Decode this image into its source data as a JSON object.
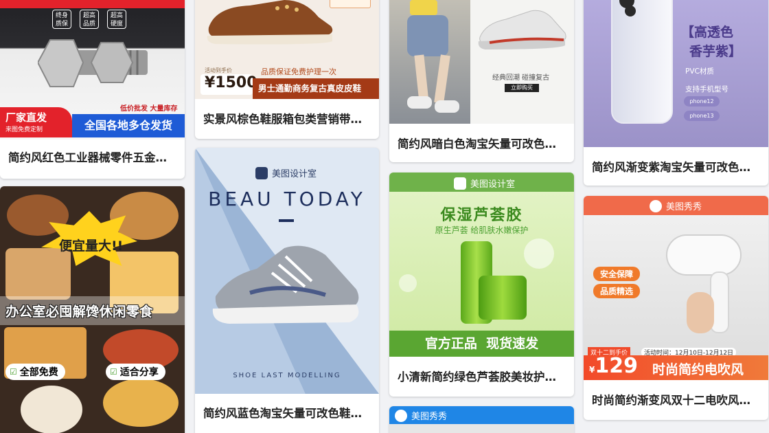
{
  "cards": [
    {
      "title": "简约风红色工业器械零件五金…",
      "image": {
        "badges": [
          "终身\n质保",
          "超高\n品质",
          "超高\n硬度"
        ],
        "tagline": "低价批发 大量库存",
        "factory_title": "厂家直发",
        "factory_sub": "来图免费定制",
        "banner": "全国各地多仓发货"
      }
    },
    {
      "title": "实景风棕色鞋服箱包类营销带…",
      "image": {
        "price_caption": "活动到手价",
        "price": "¥1500",
        "guarantee": "品质保证免费护理一次",
        "headline": "男士通勤商务复古真皮皮鞋"
      }
    },
    {
      "title": "简约风暗白色淘宝矢量可改色…",
      "image": {
        "caption": "经典回潮 碰撞复古",
        "button": "立即购买"
      }
    },
    {
      "title": "简约风渐变紫淘宝矢量可改色…",
      "image": {
        "headline_1": "【高透色",
        "headline_2": "香芋紫】",
        "material": "PVC材质",
        "support": "支持手机型号",
        "models": [
          "phone12",
          "phone13"
        ]
      }
    },
    {
      "title": "",
      "image": {
        "burst": "便宜量大!!",
        "headline": "办公室必囤解馋休闲零食",
        "labels": [
          "全部免费",
          "适合分享"
        ]
      }
    },
    {
      "title": "简约风蓝色淘宝矢量可改色鞋…",
      "image": {
        "brand": "美图设计室",
        "headline": "BEAU TODAY",
        "footer": "SHOE LAST MODELLING"
      }
    },
    {
      "title": "小清新简约绿色芦荟胶美妆护…",
      "image": {
        "brand": "美图设计室",
        "headline": "保湿芦荟胶",
        "subline": "原生芦荟 给肌肤水嫩保护",
        "banner": "官方正品  现货速发"
      }
    },
    {
      "title": "时尚简约渐变风双十二电吹风…",
      "image": {
        "brand": "美图秀秀",
        "tags": [
          "安全保障",
          "品质精选"
        ],
        "promo_caption": "双十二到手价",
        "price": "129",
        "event_time": "活动时间：12月10日-12月12日",
        "headline": "时尚简约电吹风"
      }
    },
    {
      "title": "",
      "image": {
        "brand": "美图秀秀"
      }
    }
  ],
  "colors": {
    "red": "#e3222b",
    "blue": "#1e5bd6",
    "green": "#4a9f2f",
    "purple": "#a99ed1",
    "orange": "#f06a2a"
  }
}
